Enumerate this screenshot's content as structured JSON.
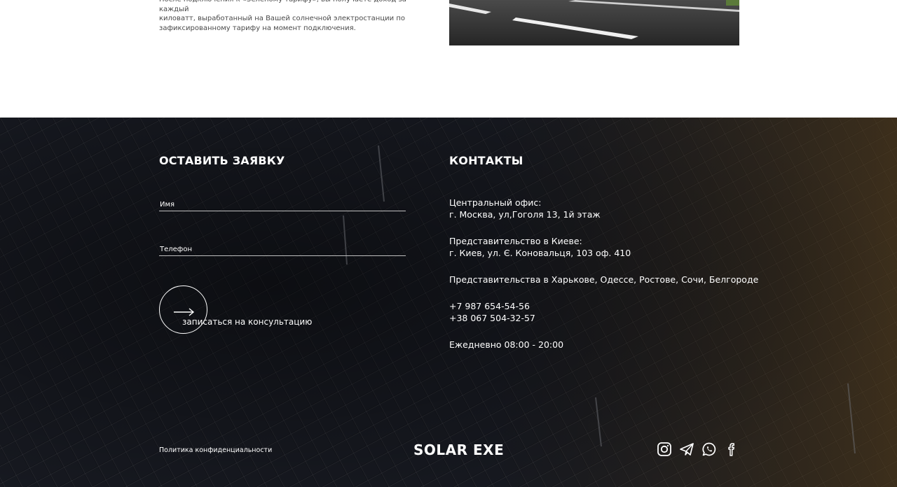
{
  "intro": {
    "text_line1": "После подключения к «Зеленому тарифу», вы получаете доход за каждый",
    "text_line2": "киловатт, выработанный на Вашей солнечной электростанции по",
    "text_line3": "зафиксированному тарифу на момент подключения."
  },
  "form": {
    "title": "ОСТАВИТЬ ЗАЯВКУ",
    "name_placeholder": "Имя",
    "phone_placeholder": "Телефон",
    "submit_label": "записаться на консультацию"
  },
  "contacts": {
    "title": "КОНТАКТЫ",
    "central_office_label": "Центральный офис:",
    "central_office_address": "г. Москва, ул,Гоголя 13, 1й этаж",
    "kiev_label": "Представительство в Киеве:",
    "kiev_address": "г. Киев, ул. Є. Коновальця, 103 оф. 410",
    "other_offices": "Представительства в Харькове, Одессе, Ростове, Сочи, Белгороде",
    "phone1": "+7 987 654-54-56",
    "phone2": "+38 067 504-32-57",
    "hours": "Ежедневно 08:00 - 20:00"
  },
  "footer": {
    "privacy_link": "Политика конфиденциальности",
    "logo_text": "SOLAR EXE",
    "socials": [
      "instagram-icon",
      "telegram-icon",
      "whatsapp-icon",
      "facebook-icon"
    ]
  }
}
